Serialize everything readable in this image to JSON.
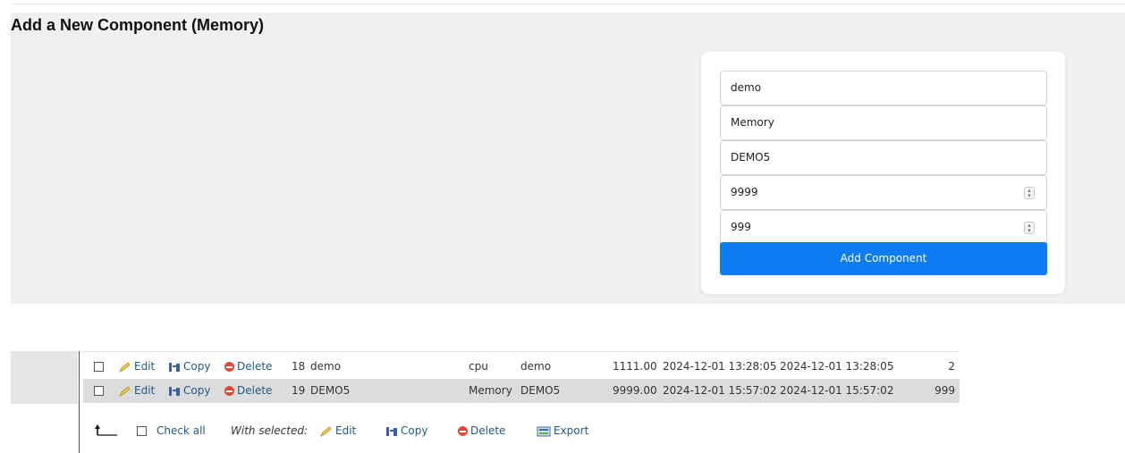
{
  "page": {
    "title": "Add a New Component (Memory)"
  },
  "form": {
    "fields": [
      {
        "value": "demo"
      },
      {
        "value": "Memory"
      },
      {
        "value": "DEMO5"
      },
      {
        "value": "9999"
      },
      {
        "value": "999"
      }
    ],
    "submit_label": "Add Component"
  },
  "table": {
    "rows": [
      {
        "id": "18",
        "name": "demo",
        "type": "cpu",
        "vendor": "demo",
        "price": "1111.00",
        "created": "2024-12-01 13:28:05",
        "updated": "2024-12-01 13:28:05",
        "qty": "2"
      },
      {
        "id": "19",
        "name": "DEMO5",
        "type": "Memory",
        "vendor": "DEMO5",
        "price": "9999.00",
        "created": "2024-12-01 15:57:02",
        "updated": "2024-12-01 15:57:02",
        "qty": "999"
      }
    ],
    "row_actions": {
      "edit": "Edit",
      "copy": "Copy",
      "delete": "Delete"
    }
  },
  "footer": {
    "check_all": "Check all",
    "with_selected": "With selected:",
    "edit": "Edit",
    "copy": "Copy",
    "delete": "Delete",
    "export": "Export"
  },
  "icons": [
    "pencil-icon",
    "copy-icon",
    "delete-icon",
    "export-icon",
    "arrow-up-icon",
    "spinner-icon"
  ],
  "colors": {
    "accent": "#0d7cf2",
    "link": "#235a81",
    "panel_bg": "#f0f0f0",
    "selected_row": "#dcdcdc",
    "delete_red": "#e04a3a"
  }
}
